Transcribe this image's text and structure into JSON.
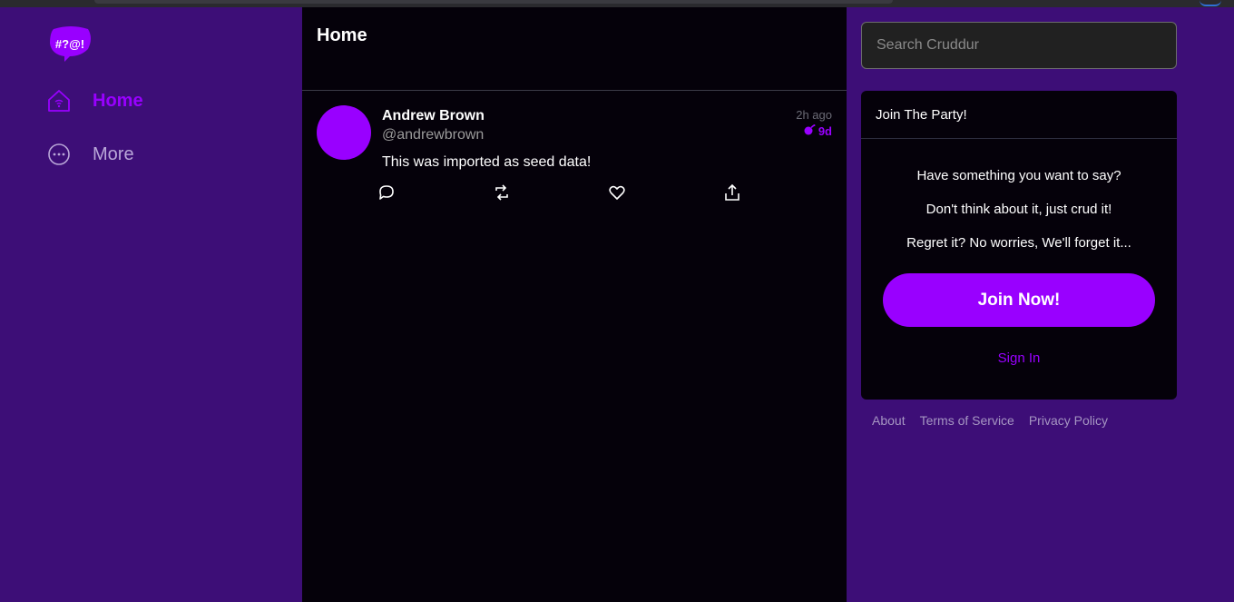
{
  "sidebar": {
    "logo_text": "#?@!",
    "items": [
      {
        "label": "Home",
        "icon": "home-icon"
      },
      {
        "label": "More",
        "icon": "more-icon"
      }
    ]
  },
  "feed": {
    "title": "Home",
    "posts": [
      {
        "display_name": "Andrew Brown",
        "handle": "@andrewbrown",
        "time_ago": "2h ago",
        "expires_in": "9d",
        "message": "This was imported as seed data!"
      }
    ]
  },
  "search": {
    "placeholder": "Search Cruddur"
  },
  "join": {
    "title": "Join The Party!",
    "lines": [
      "Have something you want to say?",
      "Don't think about it, just crud it!",
      "Regret it? No worries, We'll forget it..."
    ],
    "button_label": "Join Now!",
    "signin_label": "Sign In"
  },
  "footer": {
    "links": [
      "About",
      "Terms of Service",
      "Privacy Policy"
    ]
  },
  "colors": {
    "accent": "#9900ff",
    "sidebar_bg": "#3d0e77",
    "feed_bg": "#05010a"
  }
}
